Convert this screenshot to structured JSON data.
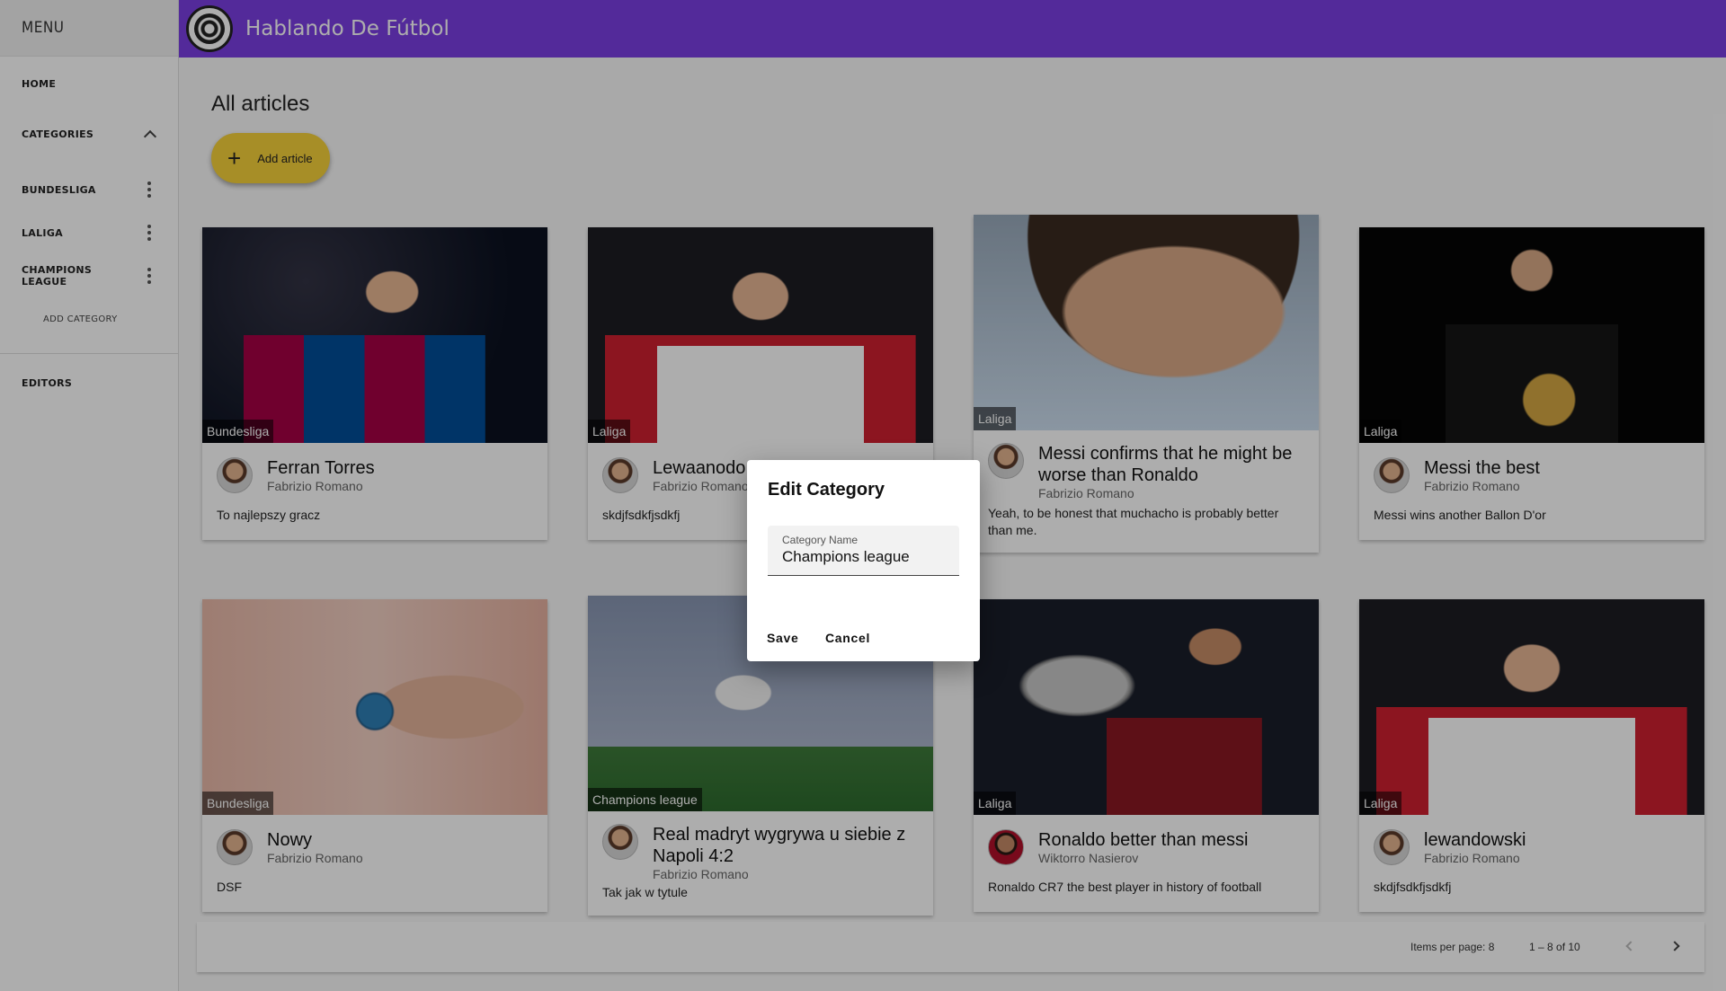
{
  "sidebar": {
    "header": "MENU",
    "home": "HOME",
    "categories": "CATEGORIES",
    "category_items": [
      {
        "label": "BUNDESLIGA"
      },
      {
        "label": "LALIGA"
      },
      {
        "label": "CHAMPIONS LEAGUE"
      }
    ],
    "add_category": "ADD CATEGORY",
    "editors": "EDITORS"
  },
  "topbar": {
    "title": "Hablando De Fútbol"
  },
  "main": {
    "title": "All articles",
    "add_button": "Add article",
    "add_icon": "plus-icon"
  },
  "articles": [
    {
      "category": "Bundesliga",
      "title": "Ferran Torres",
      "author": "Fabrizio Romano",
      "description": "To najlepszy gracz"
    },
    {
      "category": "Laliga",
      "title": "Lewaanodo",
      "author": "Fabrizio Romano",
      "description": "skdjfsdkfjsdkfj"
    },
    {
      "category": "Laliga",
      "title": "Messi confirms that he might be worse than Ronaldo",
      "author": "Fabrizio Romano",
      "description": "Yeah, to be honest that muchacho is probably better than me."
    },
    {
      "category": "Laliga",
      "title": "Messi the best",
      "author": "Fabrizio Romano",
      "description": "Messi wins another Ballon D'or"
    },
    {
      "category": "Bundesliga",
      "title": "Nowy",
      "author": "Fabrizio Romano",
      "description": "DSF"
    },
    {
      "category": "Champions league",
      "title": "Real madryt wygrywa u siebie z Napoli 4:2",
      "author": "Fabrizio Romano",
      "description": "Tak jak w tytule"
    },
    {
      "category": "Laliga",
      "title": "Ronaldo better than messi",
      "author": "Wiktorro Nasierov",
      "description": "Ronaldo CR7 the best player in history of football"
    },
    {
      "category": "Laliga",
      "title": "lewandowski",
      "author": "Fabrizio Romano",
      "description": "skdjfsdkfjsdkfj"
    }
  ],
  "paginator": {
    "items_per_page": "Items per page: 8",
    "range": "1 – 8 of 10"
  },
  "dialog": {
    "title": "Edit Category",
    "field_label": "Category Name",
    "field_value": "Champions league",
    "save": "Save",
    "cancel": "Cancel"
  },
  "colors": {
    "topbar": "#7b3fe4",
    "fab": "#f7d13a"
  }
}
